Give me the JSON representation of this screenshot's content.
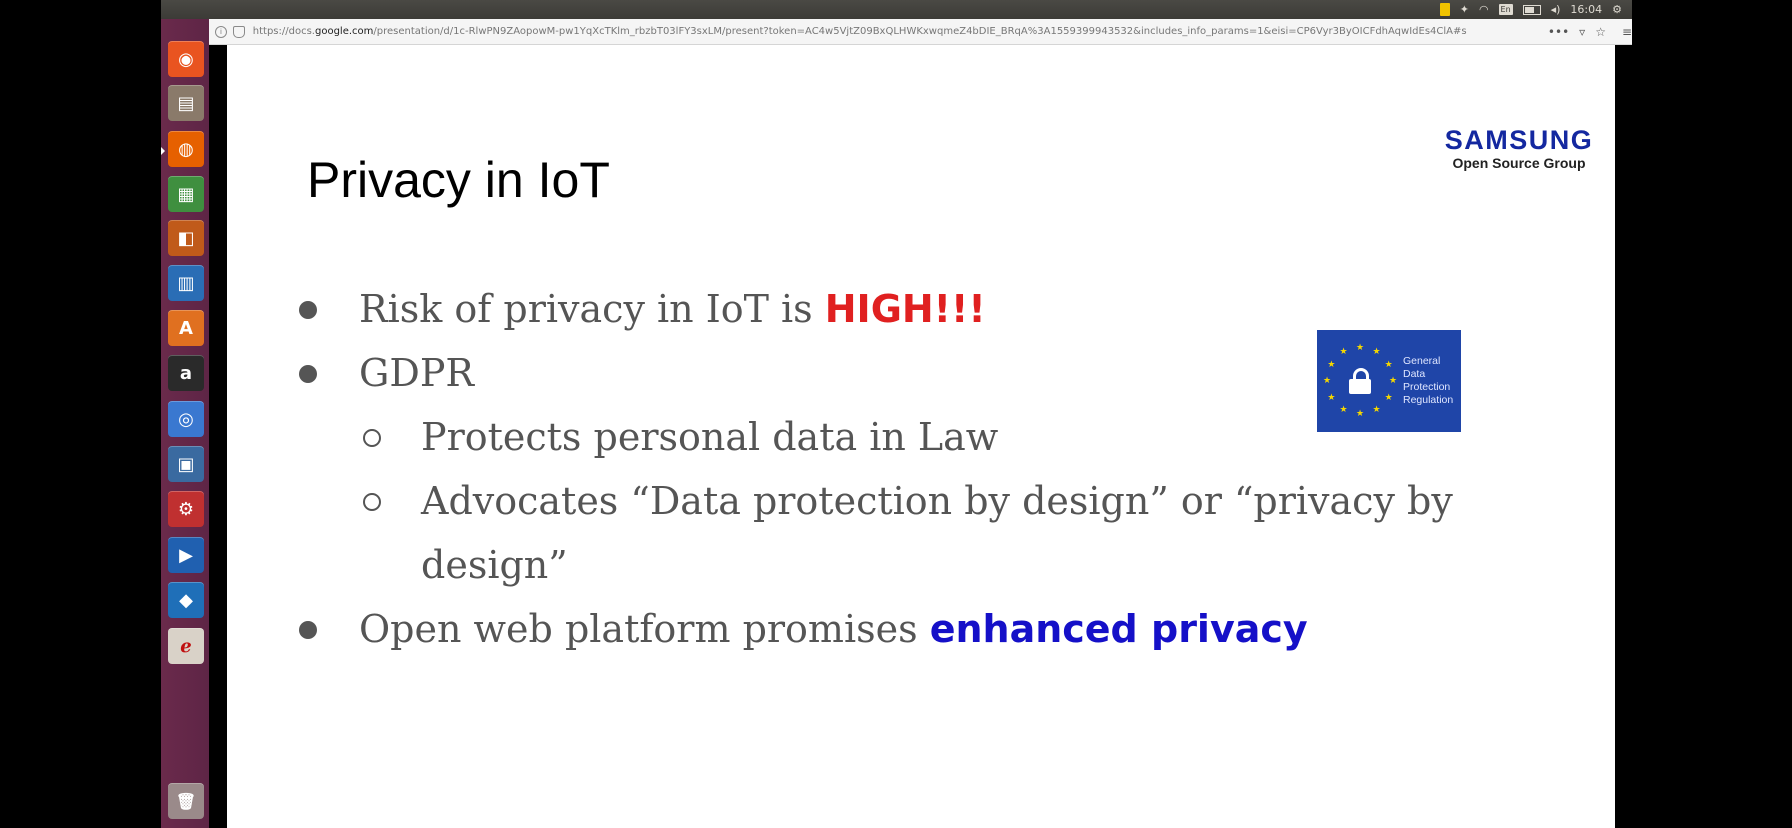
{
  "system_panel": {
    "time": "16:04"
  },
  "launcher": {
    "items": [
      {
        "name": "dash-home-icon",
        "glyph": "◉",
        "color": "#e95420"
      },
      {
        "name": "files-icon",
        "glyph": "▤",
        "color": "#8a7a6a"
      },
      {
        "name": "firefox-icon",
        "glyph": "◍",
        "color": "#e66000"
      },
      {
        "name": "spreadsheet-icon",
        "glyph": "▦",
        "color": "#3f8f3f"
      },
      {
        "name": "impress-icon",
        "glyph": "◧",
        "color": "#c05a1a"
      },
      {
        "name": "writer-icon",
        "glyph": "▥",
        "color": "#2a6db5"
      },
      {
        "name": "software-center-icon",
        "glyph": "A",
        "color": "#e07020"
      },
      {
        "name": "amazon-icon",
        "glyph": "a",
        "color": "#2a2a2a"
      },
      {
        "name": "chromium-icon",
        "glyph": "◎",
        "color": "#3a78d0"
      },
      {
        "name": "system-monitor-icon",
        "glyph": "▣",
        "color": "#3a6aa0"
      },
      {
        "name": "settings-icon",
        "glyph": "⚙",
        "color": "#c03030"
      },
      {
        "name": "media-player-icon",
        "glyph": "▶",
        "color": "#2060b0"
      },
      {
        "name": "virtualbox-icon",
        "glyph": "◆",
        "color": "#1f6fb8"
      },
      {
        "name": "pdf-viewer-icon",
        "glyph": "ℯ",
        "color": "#d9d2c8"
      }
    ],
    "trash": {
      "name": "trash-icon",
      "glyph": "🗑",
      "color": "#9a8a8a"
    }
  },
  "browser": {
    "url_host_prefix": "https://docs.",
    "url_host": "google.com",
    "url_rest": "/presentation/d/1c-RlwPN9ZAopowM-pw1YqXcTKlm_rbzbT03lFY3sxLM/present?token=AC4w5VjtZ09BxQLHWKxwqmeZ4bDIE_BRqA%3A1559399943532&includes_info_params=1&eisi=CP6Vyr3ByOICFdhAqwIdEs4ClA#s",
    "page_actions": "•••",
    "pocket_glyph": "▿",
    "bookmark_glyph": "☆",
    "menu_glyph": "≡"
  },
  "slide": {
    "title": "Privacy in IoT",
    "logo": {
      "wordmark": "SAMSUNG",
      "subtitle": "Open Source Group"
    },
    "bullets": [
      {
        "level": 1,
        "text": "Risk of privacy in IoT is ",
        "highlight": "HIGH!!!",
        "highlight_color": "#e02020"
      },
      {
        "level": 1,
        "text": "GDPR",
        "highlight": ""
      },
      {
        "level": 2,
        "text": "Protects personal data in Law",
        "highlight": ""
      },
      {
        "level": 2,
        "text": "Advocates “Data protection by design” or “privacy by",
        "highlight": ""
      },
      {
        "level": 0,
        "text": "design”",
        "highlight": ""
      },
      {
        "level": 1,
        "text": "Open web platform promises ",
        "highlight": "enhanced privacy",
        "highlight_color": "#1510c8"
      }
    ],
    "gdpr_badge": {
      "lines": [
        "General",
        "Data",
        "Protection",
        "Regulation"
      ],
      "background": "#1f45a8",
      "star_color": "#f5d700"
    }
  }
}
